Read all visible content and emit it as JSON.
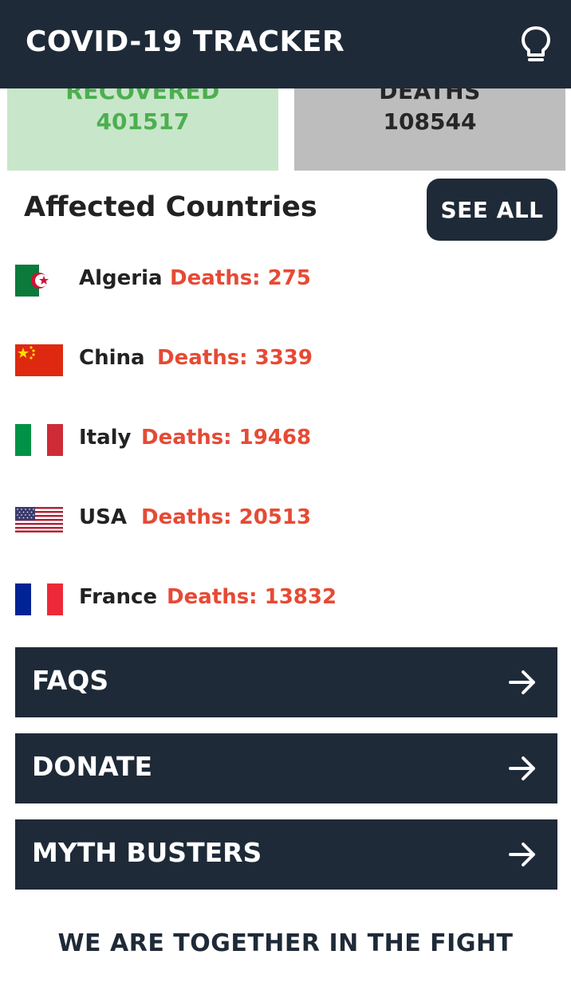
{
  "header": {
    "title": "COVID-19 TRACKER",
    "icon": "lightbulb-icon"
  },
  "stats": {
    "recovered": {
      "label": "RECOVERED",
      "value": "401517",
      "color": "#4caf50",
      "bg": "#c8e6c9"
    },
    "deaths": {
      "label": "DEATHS",
      "value": "108544",
      "color": "#262626",
      "bg": "#bdbdbd"
    }
  },
  "affected": {
    "title": "Affected Countries",
    "see_all": "SEE ALL",
    "countries": [
      {
        "name": "Algeria",
        "deaths": "Deaths: 275"
      },
      {
        "name": "China",
        "deaths": "Deaths: 3339"
      },
      {
        "name": "Italy",
        "deaths": "Deaths: 19468"
      },
      {
        "name": "USA",
        "deaths": "Deaths: 20513"
      },
      {
        "name": "France",
        "deaths": "Deaths: 13832"
      }
    ]
  },
  "links": [
    {
      "label": "FAQS",
      "icon": "arrow-right-icon"
    },
    {
      "label": "DONATE",
      "icon": "arrow-right-icon"
    },
    {
      "label": "MYTH BUSTERS",
      "icon": "arrow-right-icon"
    }
  ],
  "footer": {
    "text": "WE ARE TOGETHER IN THE FIGHT"
  },
  "colors": {
    "primary": "#1f2a38",
    "deaths_text": "#e64a35"
  }
}
